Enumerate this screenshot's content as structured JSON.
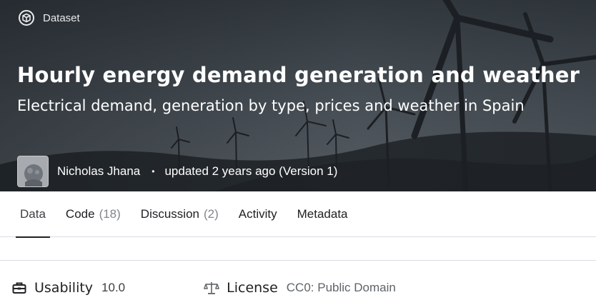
{
  "header": {
    "type_label": "Dataset",
    "title": "Hourly energy demand generation and weather",
    "subtitle": "Electrical demand, generation by type, prices and weather in Spain",
    "author": "Nicholas Jhana",
    "separator": "•",
    "updated": "updated 2 years ago (Version 1)"
  },
  "tabs": [
    {
      "label": "Data",
      "count": ""
    },
    {
      "label": "Code",
      "count": "(18)"
    },
    {
      "label": "Discussion",
      "count": "(2)"
    },
    {
      "label": "Activity",
      "count": ""
    },
    {
      "label": "Metadata",
      "count": ""
    }
  ],
  "info": {
    "usability_label": "Usability",
    "usability_value": "10.0",
    "license_label": "License",
    "license_value": "CC0: Public Domain"
  },
  "icons": {
    "dataset": "dataset-cube-icon",
    "usability": "toolbox-icon",
    "license": "scales-icon"
  }
}
